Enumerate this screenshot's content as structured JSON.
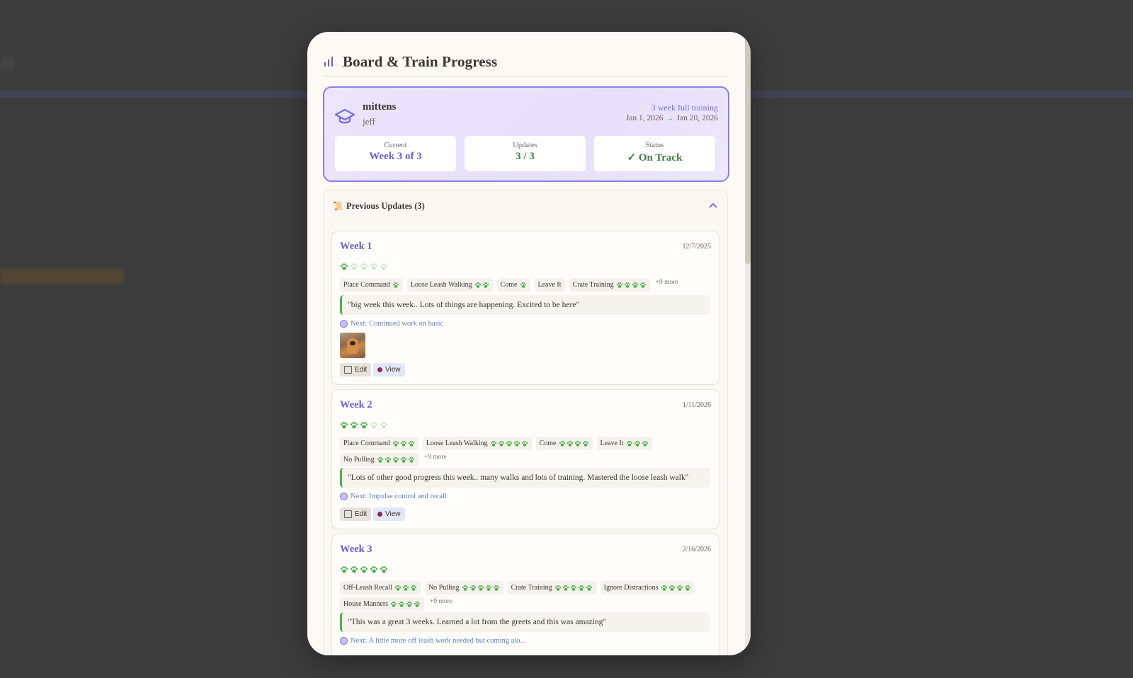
{
  "modal": {
    "title": "Board & Train Progress",
    "icon": "bar-chart-icon"
  },
  "summary": {
    "dog_name": "mittens",
    "owner": "jeff",
    "program": "3 week full training",
    "start_date": "Jan 1, 2026",
    "end_date": "Jan 20, 2026",
    "arrow": "→",
    "stats": [
      {
        "label": "Current",
        "value": "Week 3 of 3"
      },
      {
        "label": "Updates",
        "value": "3 / 3"
      },
      {
        "label": "Status",
        "value": "On Track",
        "check": "✓"
      }
    ]
  },
  "previous": {
    "emoji": "📜",
    "title": "Previous Updates (3)"
  },
  "weeks": [
    {
      "title": "Week 1",
      "date": "12/7/2025",
      "rating": 1,
      "rating_max": 5,
      "skills": [
        {
          "name": "Place Command",
          "paws": 1
        },
        {
          "name": "Loose Leash Walking",
          "paws": 2
        },
        {
          "name": "Come",
          "paws": 1
        },
        {
          "name": "Leave It",
          "paws": 0
        },
        {
          "name": "Crate Training",
          "paws": 4
        }
      ],
      "more": "+9 more",
      "quote": "\"big week this week.. Lots of things are happening. Excited to be here\"",
      "next": "Next: Continued work on basic",
      "has_photo": true,
      "edit_label": "Edit",
      "view_label": "View"
    },
    {
      "title": "Week 2",
      "date": "1/11/2026",
      "rating": 3,
      "rating_max": 5,
      "skills": [
        {
          "name": "Place Command",
          "paws": 3
        },
        {
          "name": "Loose Leash Walking",
          "paws": 5
        },
        {
          "name": "Come",
          "paws": 4
        },
        {
          "name": "Leave It",
          "paws": 3
        },
        {
          "name": "No Pulling",
          "paws": 5
        }
      ],
      "more": "+9 more",
      "quote": "\"Lots of other good progress this week.. many walks and lots of training. Mastered the loose leash walk\"",
      "next": "Next: Impulse control and recall",
      "has_photo": false,
      "edit_label": "Edit",
      "view_label": "View"
    },
    {
      "title": "Week 3",
      "date": "2/16/2026",
      "rating": 5,
      "rating_max": 5,
      "skills": [
        {
          "name": "Off-Leash Recall",
          "paws": 3
        },
        {
          "name": "No Pulling",
          "paws": 5
        },
        {
          "name": "Crate Training",
          "paws": 5
        },
        {
          "name": "Ignore Distractions",
          "paws": 4
        },
        {
          "name": "House Manners",
          "paws": 4
        }
      ],
      "more": "+9 more",
      "quote": "\"This was a great 3 weeks. Learned a lot from the greets and this was amazing\"",
      "next": "Next: A little more off leash work needed but coming alo...",
      "has_photo": false
    }
  ],
  "colors": {
    "accent": "#6a5ed6",
    "paw_filled": "#4caf50",
    "paw_empty": "#cfe5cf",
    "status_green": "#3b7a3f"
  }
}
